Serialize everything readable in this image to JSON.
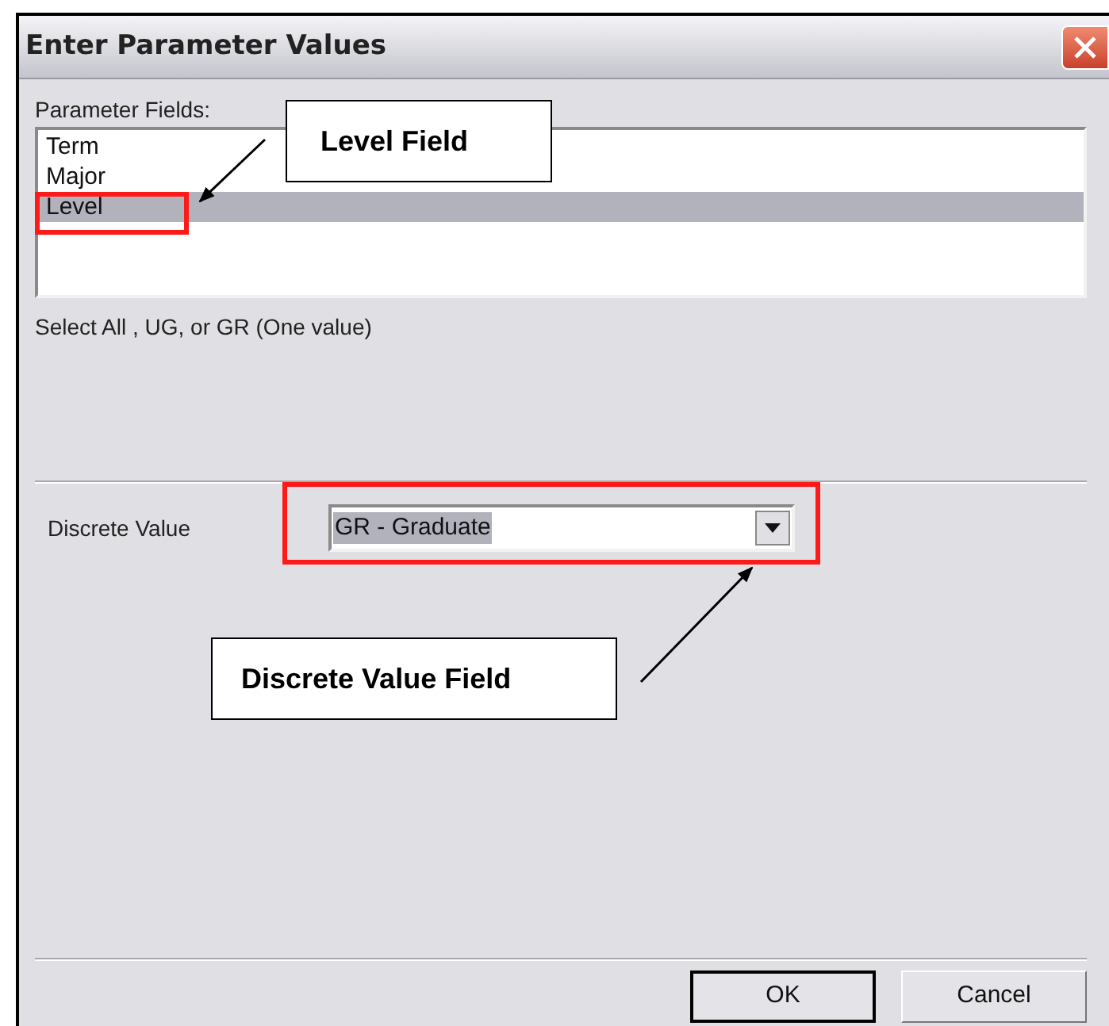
{
  "window": {
    "title": "Enter Parameter Values"
  },
  "parameter_fields": {
    "label": "Parameter Fields:",
    "items": [
      {
        "name": "Term",
        "selected": false
      },
      {
        "name": "Major",
        "selected": false
      },
      {
        "name": "Level",
        "selected": true
      }
    ]
  },
  "description": "Select All , UG, or GR (One value)",
  "discrete_value": {
    "label": "Discrete Value",
    "value": "GR - Graduate"
  },
  "buttons": [
    {
      "label": "OK",
      "default": true
    },
    {
      "label": "Cancel",
      "default": false
    }
  ],
  "annotations": [
    {
      "text": "Level Field"
    },
    {
      "text": "Discrete Value Field"
    }
  ]
}
